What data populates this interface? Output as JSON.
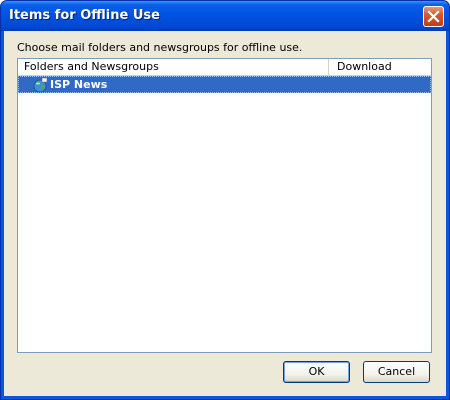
{
  "window": {
    "title": "Items for Offline Use"
  },
  "prompt": "Choose mail folders and newsgroups for offline use.",
  "list": {
    "columns": [
      {
        "label": "Folders and Newsgroups"
      },
      {
        "label": "Download"
      }
    ],
    "rows": [
      {
        "label": "ISP News",
        "icon": "globe-news-icon",
        "selected": true
      }
    ]
  },
  "buttons": {
    "ok": "OK",
    "cancel": "Cancel"
  },
  "colors": {
    "titlebar": "#0054e3",
    "selection": "#316ac5",
    "close": "#d9572f",
    "dialog_bg": "#ece9d8"
  }
}
